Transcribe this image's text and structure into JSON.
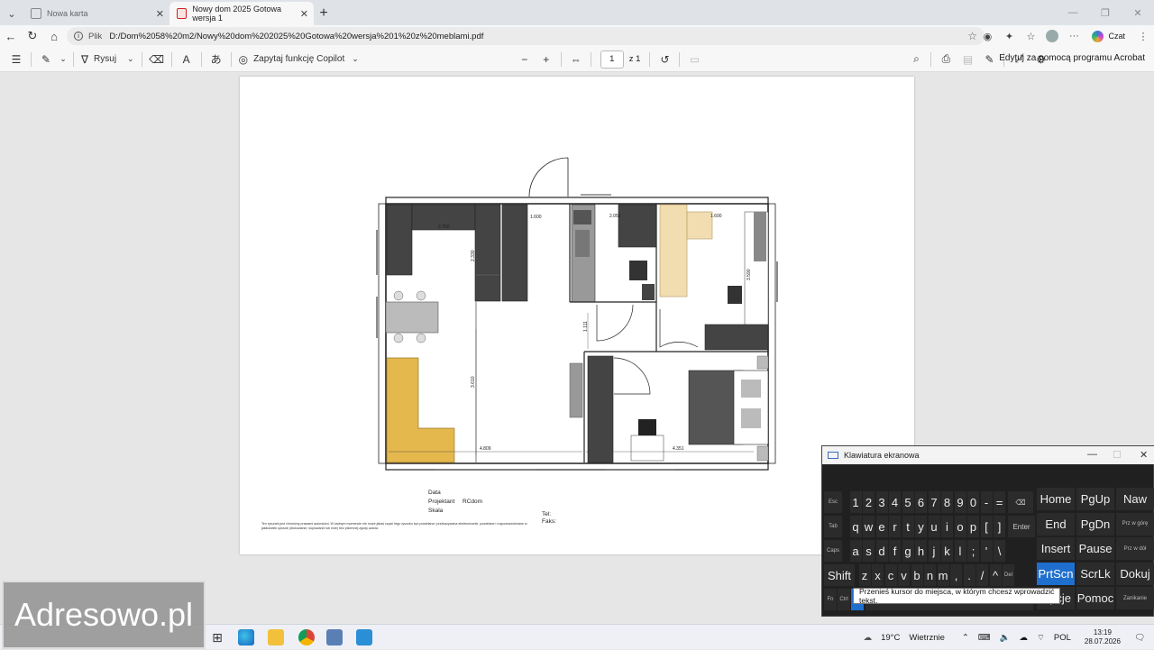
{
  "browser": {
    "tabs": [
      {
        "label": "Nowa karta",
        "active": false
      },
      {
        "label": "Nowy dom 2025 Gotowa wersja 1",
        "active": true
      }
    ],
    "address": {
      "scheme_label": "Plik",
      "url": "D:/Dom%2058%20m2/Nowy%20dom%202025%20Gotowa%20wersja%201%20z%20meblami.pdf"
    },
    "chat_label": "Czat"
  },
  "pdf_toolbar": {
    "draw_label": "Rysuj",
    "copilot_label": "Zapytaj funkcję Copilot",
    "page_current": "1",
    "page_of": "z 1",
    "acrobat_label": "Edytuj za pomocą programu Acrobat"
  },
  "plan": {
    "dimensions": [
      "2.750",
      "1.600",
      "2.050",
      "1.600",
      "2.330",
      "3.590",
      "1.111",
      "3.610",
      "4.809",
      "4.351"
    ]
  },
  "titleblock": {
    "data_label": "Data",
    "projektant_label": "Projektant",
    "projektant_value": "RCdom",
    "skala_label": "Skala",
    "tel_label": "Tel:",
    "faks_label": "Faks:",
    "disclaimer": "Ten rysunek jest chroniony prawami autorskimi. W żadnym momencie nie może jakaś część tego rysunku być powielana i przekazywana elektronicznie, powielane i rozpowszechniane w jakikolwiek sposób (drukowanie, kopiowanie lub inne) bez pisemnej zgody autora."
  },
  "watermark": "Adresowo.pl",
  "keyboard": {
    "title": "Klawiatura ekranowa",
    "tooltip": "Przenieś kursor do miejsca, w którym chcesz wprowadzić tekst.",
    "row1": [
      "Esc",
      "1",
      "2",
      "3",
      "4",
      "5",
      "6",
      "7",
      "8",
      "9",
      "0",
      "-",
      "="
    ],
    "row2": [
      "Tab",
      "q",
      "w",
      "e",
      "r",
      "t",
      "y",
      "u",
      "i",
      "o",
      "p",
      "[",
      "]"
    ],
    "row3": [
      "Caps",
      "a",
      "s",
      "d",
      "f",
      "g",
      "h",
      "j",
      "k",
      "l",
      ";",
      "'",
      "\\"
    ],
    "row4": [
      "Shift",
      "z",
      "x",
      "c",
      "v",
      "b",
      "n",
      "m",
      ",",
      ".",
      "/",
      "^",
      "Del"
    ],
    "enter": "Enter",
    "fn": "Fn",
    "ctrl": "Ctrl",
    "nav": [
      [
        "Home",
        "PgUp",
        "Naw"
      ],
      [
        "End",
        "PgDn",
        "Prz w górę"
      ],
      [
        "Insert",
        "Pause",
        "Prz w dół"
      ],
      [
        "PrtScn",
        "ScrLk",
        "Dokuj"
      ],
      [
        "Opcje",
        "Pomoc",
        "Zanikanie"
      ]
    ]
  },
  "taskbar": {
    "weather_temp": "19°C",
    "weather_desc": "Wietrznie",
    "language": "POL",
    "time": "13:19",
    "date": "28.07.2026"
  }
}
